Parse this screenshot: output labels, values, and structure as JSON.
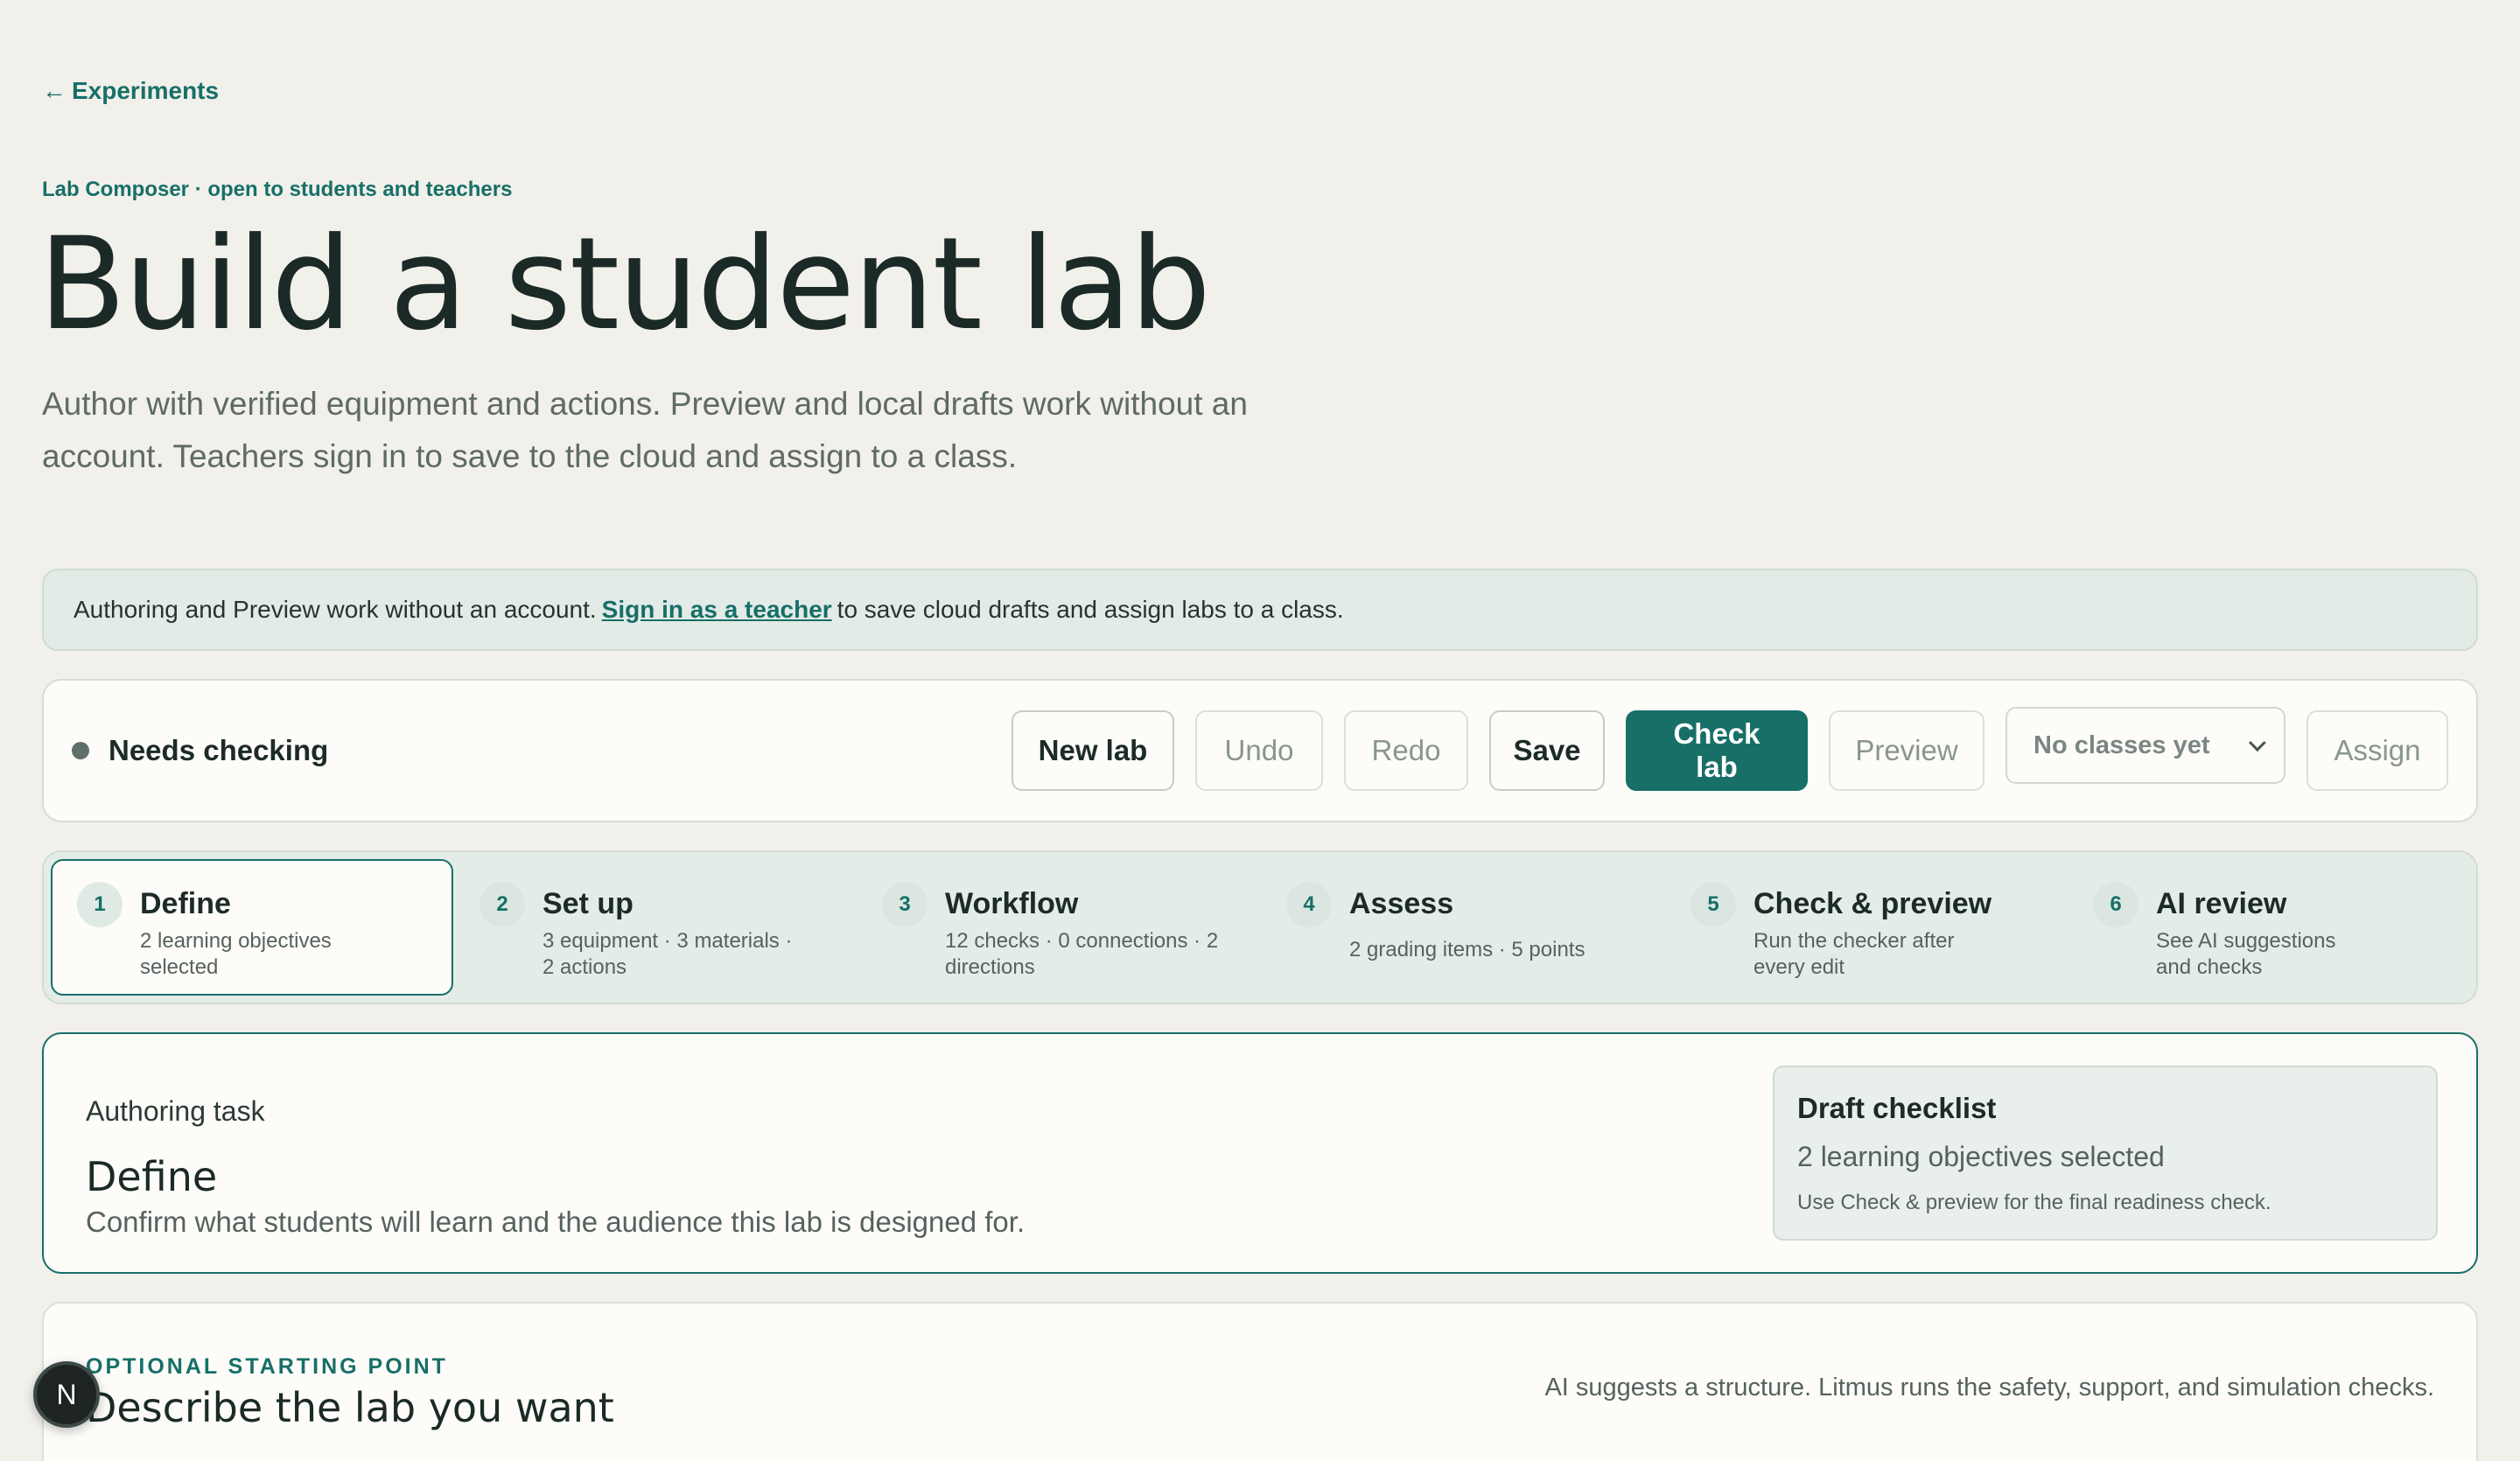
{
  "nav": {
    "back_arrow": "←",
    "back_label": "Experiments"
  },
  "header": {
    "eyebrow": "Lab Composer · open to students and teachers",
    "title": "Build a student lab",
    "subtitle": "Author with verified equipment and actions. Preview and local drafts work without an account. Teachers sign in to save to the cloud and assign to a class."
  },
  "notice": {
    "before": "Authoring and Preview work without an account.",
    "link": "Sign in as a teacher",
    "after": "to save cloud drafts and assign labs to a class."
  },
  "toolbar": {
    "status": "Needs checking",
    "buttons": {
      "new_lab": "New lab",
      "undo": "Undo",
      "redo": "Redo",
      "save": "Save",
      "check_lab": "Check lab",
      "preview": "Preview",
      "assign": "Assign"
    },
    "class_select": "No classes yet"
  },
  "steps": [
    {
      "num": "1",
      "title": "Define",
      "desc": "2 learning objectives selected"
    },
    {
      "num": "2",
      "title": "Set up",
      "desc": "3 equipment · 3 materials · 2 actions"
    },
    {
      "num": "3",
      "title": "Workflow",
      "desc": "12 checks · 0 connections · 2 directions"
    },
    {
      "num": "4",
      "title": "Assess",
      "desc": "2 grading items · 5 points"
    },
    {
      "num": "5",
      "title": "Check & preview",
      "desc": "Run the checker after every edit"
    },
    {
      "num": "6",
      "title": "AI review",
      "desc": "See AI suggestions and checks"
    }
  ],
  "task": {
    "label": "Authoring task",
    "title": "Define",
    "desc": "Confirm what students will learn and the audience this lab is designed for.",
    "checklist": {
      "title": "Draft checklist",
      "value": "2 learning objectives selected",
      "note": "Use Check & preview for the final readiness check."
    }
  },
  "optional": {
    "eyebrow": "OPTIONAL STARTING POINT",
    "title": "Describe the lab you want",
    "note": "AI suggests a structure. Litmus runs the safety, support, and simulation checks."
  },
  "avatar": {
    "initial": "N"
  },
  "colors": {
    "accent": "#176f68",
    "background": "#f2f0ea",
    "card": "#fdfcf8"
  }
}
